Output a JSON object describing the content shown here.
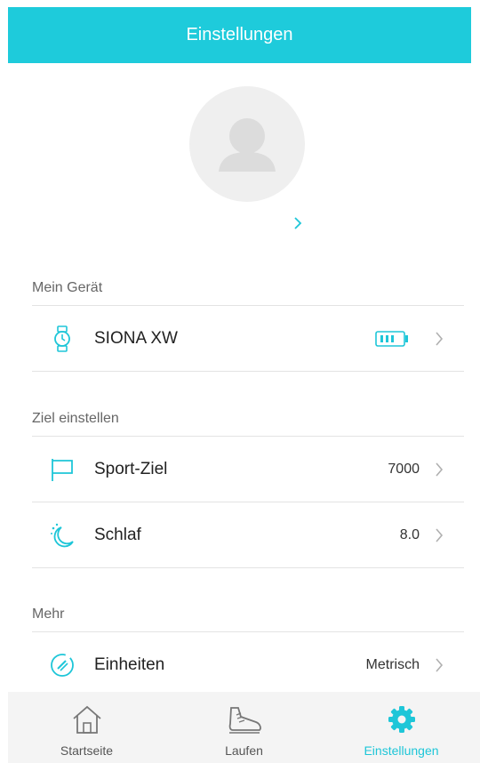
{
  "header": {
    "title": "Einstellungen"
  },
  "profile": {
    "username": ""
  },
  "sections": {
    "device": {
      "label": "Mein Gerät",
      "item": {
        "title": "SIONA XW"
      }
    },
    "goals": {
      "label": "Ziel einstellen",
      "sport": {
        "title": "Sport-Ziel",
        "value": "7000"
      },
      "sleep": {
        "title": "Schlaf",
        "value": "8.0"
      }
    },
    "more": {
      "label": "Mehr",
      "units": {
        "title": "Einheiten",
        "value": "Metrisch"
      }
    }
  },
  "tabs": [
    {
      "label": "Startseite",
      "icon": "home-icon"
    },
    {
      "label": "Laufen",
      "icon": "shoe-icon"
    },
    {
      "label": "Einstellungen",
      "icon": "gear-icon",
      "active": true
    }
  ],
  "colors": {
    "accent": "#1ecbdb",
    "tabbar_bg": "#f4f4f4"
  }
}
